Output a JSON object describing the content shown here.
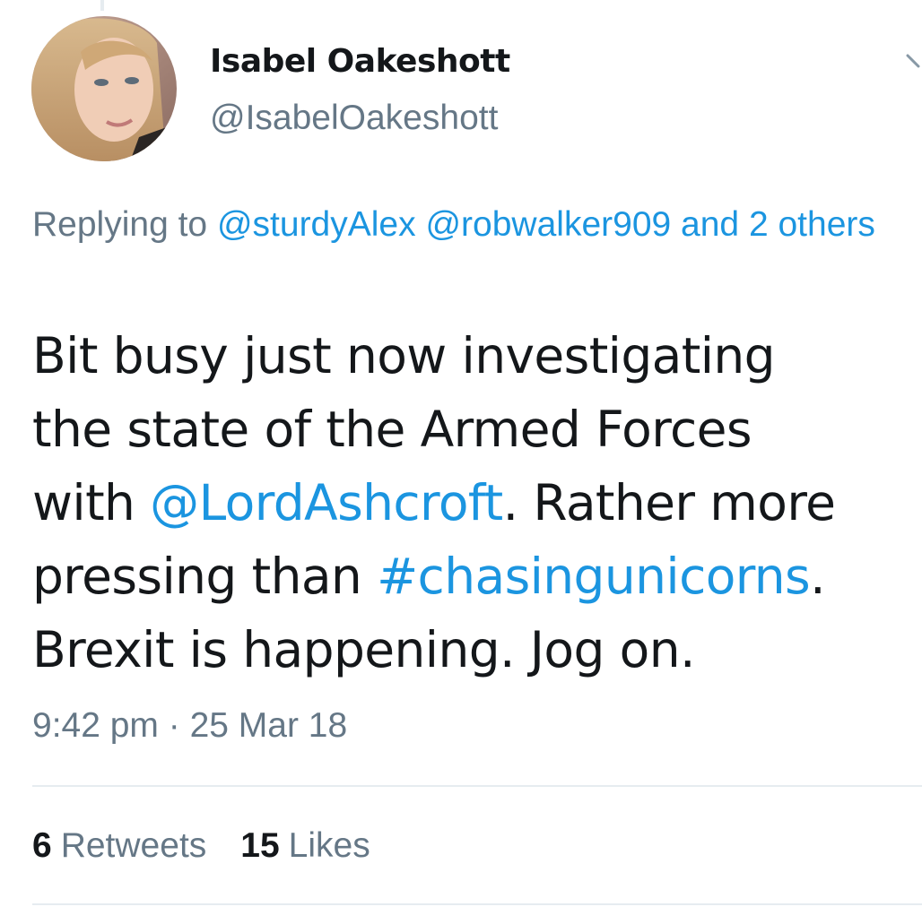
{
  "tweet": {
    "author": {
      "display_name": "Isabel Oakeshott",
      "handle": "@IsabelOakeshott",
      "avatar_icon": "profile-photo"
    },
    "reply_to": {
      "prefix": "Replying to ",
      "mention_1": "@sturdyAlex",
      "mention_2": "@robwalker909",
      "others": "and 2 others"
    },
    "text": {
      "line_1": "Bit busy just now investigating",
      "line_2": "the state of the Armed Forces",
      "line_3_pre": "with ",
      "line_3_mention": "@LordAshcroft",
      "line_3_post": ". Rather more",
      "line_4_pre": "pressing than ",
      "line_4_hashtag": "#chasingunicorns",
      "line_4_post": ".",
      "line_5": "Brexit is happening. Jog on."
    },
    "timestamp": "9:42 pm · 25 Mar 18",
    "stats": {
      "retweets_count": "6",
      "retweets_label": "Retweets",
      "likes_count": "15",
      "likes_label": "Likes"
    },
    "colors": {
      "link": "#1b95e0",
      "secondary_text": "#657786",
      "primary_text": "#14171a",
      "divider": "#e6ecf0"
    },
    "menu_icon": "chevron-down-icon"
  }
}
